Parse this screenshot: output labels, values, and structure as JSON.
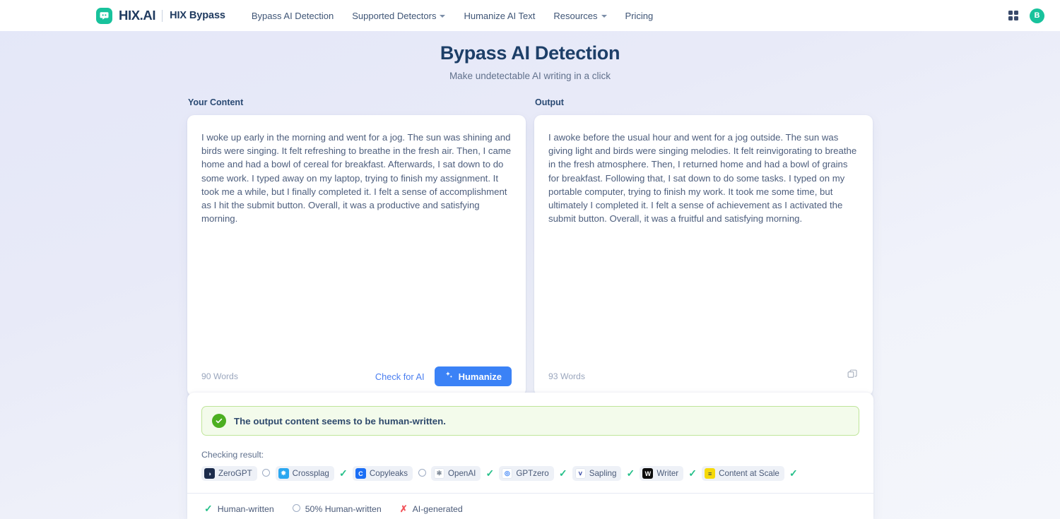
{
  "header": {
    "logo_text": "HIX.AI",
    "logo_icon": "chat-bubble-icon",
    "product_name": "HIX Bypass",
    "nav": [
      {
        "label": "Bypass AI Detection",
        "has_dropdown": false
      },
      {
        "label": "Supported Detectors",
        "has_dropdown": true
      },
      {
        "label": "Humanize AI Text",
        "has_dropdown": false
      },
      {
        "label": "Resources",
        "has_dropdown": true
      },
      {
        "label": "Pricing",
        "has_dropdown": false
      }
    ],
    "apps_icon": "grid-apps-icon",
    "avatar_initial": "B",
    "avatar_color": "#18c29c"
  },
  "page": {
    "title": "Bypass AI Detection",
    "subtitle": "Make undetectable AI writing in a click"
  },
  "input_panel": {
    "label": "Your Content",
    "text": "I woke up early in the morning and went for a jog. The sun was shining and birds were singing. It felt refreshing to breathe in the fresh air. Then, I came home and had a bowl of cereal for breakfast. Afterwards, I sat down to do some work. I typed away on my laptop, trying to finish my assignment. It took me a while, but I finally completed it. I felt a sense of accomplishment as I hit the submit button. Overall, it was a productive and satisfying morning.",
    "word_count": "90 Words",
    "check_link": "Check for AI",
    "humanize_button": "Humanize",
    "humanize_icon": "sparkle-icon",
    "humanize_color": "#3b82f6"
  },
  "output_panel": {
    "label": "Output",
    "text": "I awoke before the usual hour and went for a jog outside. The sun was giving light and birds were singing melodies. It felt reinvigorating to breathe in the fresh atmosphere. Then, I returned home and had a bowl of grains for breakfast. Following that, I sat down to do some tasks. I typed on my portable computer, trying to finish my work. It took me some time, but ultimately I completed it. I felt a sense of achievement as I activated the submit button. Overall, it was a fruitful and satisfying morning.",
    "word_count": "93 Words",
    "copy_icon": "copy-icon"
  },
  "result": {
    "banner_text": "The output content seems to be human-written.",
    "banner_icon": "check-circle-icon",
    "banner_bg": "#f3fbeb",
    "banner_border": "#bfe59a",
    "checking_label": "Checking result:",
    "detectors": [
      {
        "name": "ZeroGPT",
        "status": "half",
        "logo_bg": "#1b2b4b",
        "logo_fg": "#cfd8ea",
        "logo_char": "◑"
      },
      {
        "name": "Crossplag",
        "status": "pass",
        "logo_bg": "#2aa7f0",
        "logo_fg": "#ffffff",
        "logo_char": "✸"
      },
      {
        "name": "Copyleaks",
        "status": "half",
        "logo_bg": "#1b6ef5",
        "logo_fg": "#ffffff",
        "logo_char": "C"
      },
      {
        "name": "OpenAI",
        "status": "pass",
        "logo_bg": "#ffffff",
        "logo_fg": "#74808f",
        "logo_char": "✻"
      },
      {
        "name": "GPTzero",
        "status": "pass",
        "logo_bg": "#ffffff",
        "logo_fg": "#3b82f6",
        "logo_char": "◎"
      },
      {
        "name": "Sapling",
        "status": "pass",
        "logo_bg": "#ffffff",
        "logo_fg": "#3b4da8",
        "logo_char": "ⅴ"
      },
      {
        "name": "Writer",
        "status": "pass",
        "logo_bg": "#0d0d0d",
        "logo_fg": "#ffffff",
        "logo_char": "W"
      },
      {
        "name": "Content at Scale",
        "status": "pass",
        "logo_bg": "#f5d90a",
        "logo_fg": "#2b3a55",
        "logo_char": "≡"
      }
    ],
    "legend": [
      {
        "label": "Human-written",
        "mark": "tick"
      },
      {
        "label": "50% Human-written",
        "mark": "circle"
      },
      {
        "label": "AI-generated",
        "mark": "cross"
      }
    ],
    "tick_color": "#26c08a",
    "cross_color": "#f2535a"
  }
}
